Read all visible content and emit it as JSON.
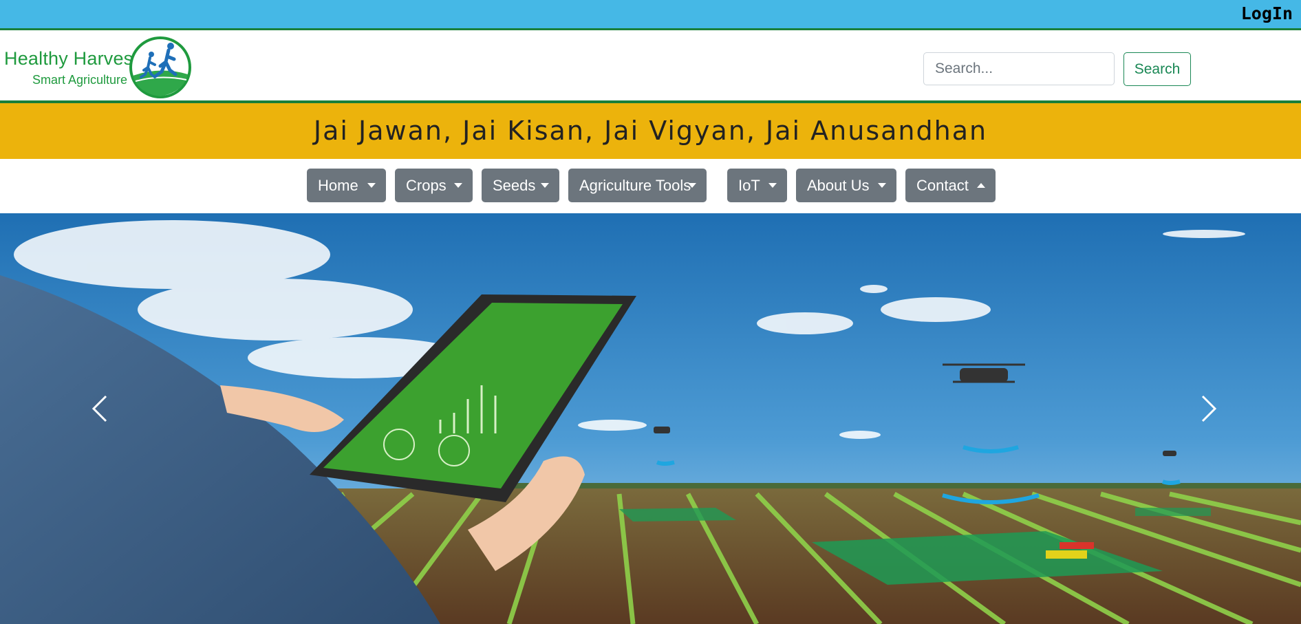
{
  "topbar": {
    "login_label": "LogIn"
  },
  "brand": {
    "name": "Healthy Harvest",
    "tagline": "Smart Agriculture"
  },
  "search": {
    "placeholder": "Search...",
    "value": "",
    "button_label": "Search"
  },
  "motto": "Jai Jawan, Jai Kisan, Jai Vigyan, Jai Anusandhan",
  "nav": {
    "items": [
      {
        "label": "Home",
        "expanded": false
      },
      {
        "label": "Crops",
        "expanded": false
      },
      {
        "label": "Seeds",
        "expanded": false
      },
      {
        "label": "Agriculture Tools",
        "expanded": false
      },
      {
        "label": "IoT",
        "expanded": false
      },
      {
        "label": "About Us",
        "expanded": false
      },
      {
        "label": "Contact",
        "expanded": true
      }
    ]
  },
  "carousel": {
    "prev_icon": "chevron-left-icon",
    "next_icon": "chevron-right-icon"
  },
  "colors": {
    "topbar": "#45b8e6",
    "brand_green": "#1f9a3e",
    "motto_band": "#ecb30c",
    "nav_button": "#6c757d",
    "search_outline": "#198754"
  }
}
